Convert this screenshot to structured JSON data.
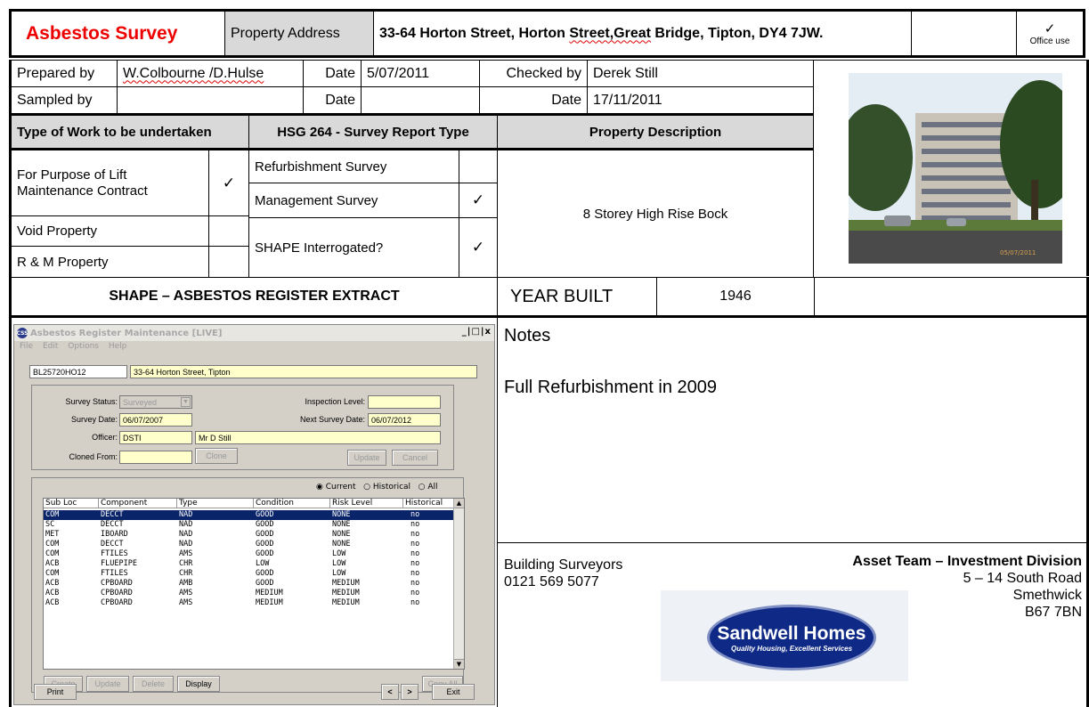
{
  "header": {
    "title": "Asbestos Survey",
    "address_label": "Property Address",
    "address_value_a": "33-64 Horton Street, Horton ",
    "address_value_b": "Street,Great",
    "address_value_c": " Bridge, Tipton, DY4 7JW.",
    "check": "✓",
    "office_use": "Office use"
  },
  "info": {
    "prepared_label": "Prepared by",
    "prepared_value": "W.Colbourne /D.Hulse",
    "date_label": "Date",
    "date1": "5/07/2011",
    "checked_label": "Checked by",
    "checked_value": "Derek Still",
    "sampled_label": "Sampled by",
    "date2_label": "Date",
    "date3_label": "Date",
    "date3": "17/11/2011"
  },
  "sections": {
    "work_type": "Type of Work to be undertaken",
    "hsg": "HSG 264 - Survey Report Type",
    "prop_desc": "Property Description"
  },
  "work": {
    "lift_line1": "For Purpose of Lift",
    "lift_line2": "Maintenance Contract",
    "lift_check": "✓",
    "void": "Void Property",
    "rm": "R & M Property"
  },
  "survey": {
    "refurb": "Refurbishment Survey",
    "mgmt": "Management Survey",
    "mgmt_check": "✓",
    "shape": "SHAPE Interrogated?",
    "shape_check": "✓"
  },
  "property": {
    "description": "8 Storey High Rise Bock",
    "photo_date": "05/07/2011"
  },
  "register_title": "SHAPE – ASBESTOS REGISTER EXTRACT",
  "year": {
    "label": "YEAR BUILT",
    "value": "1946"
  },
  "notes": {
    "label": "Notes",
    "text": "Full Refurbishment in 2009"
  },
  "contact": {
    "dept": "Building Surveyors",
    "phone": "0121 569 5077",
    "team": "Asset Team – Investment Division",
    "addr1": "5 – 14 South Road",
    "addr2": "Smethwick",
    "addr3": "B67 7BN"
  },
  "logo": {
    "name": "Sandwell Homes",
    "tagline": "Quality Housing, Excellent Services"
  },
  "window": {
    "title": "Asbestos Register Maintenance [LIVE]",
    "icon": "CSS",
    "controls": "_|□|x",
    "menu": [
      "File",
      "Edit",
      "Options",
      "Help"
    ],
    "ref": "BL25720HO12",
    "address": "33-64 Horton Street, Tipton",
    "survey_status_label": "Survey Status:",
    "survey_status": "Surveyed",
    "inspection_label": "Inspection Level:",
    "survey_date_label": "Survey Date:",
    "survey_date": "06/07/2007",
    "next_survey_label": "Next Survey Date:",
    "next_survey": "06/07/2012",
    "officer_label": "Officer:",
    "officer_code": "DSTI",
    "officer_name": "Mr D Still",
    "cloned_label": "Cloned From:",
    "clone_btn": "Clone",
    "update_btn": "Update",
    "cancel_btn": "Cancel",
    "radio_current": "Current",
    "radio_historical": "Historical",
    "radio_all": "All",
    "columns": [
      "Sub Loc",
      "Component",
      "Type",
      "Condition",
      "Risk Level",
      "Historical"
    ],
    "rows": [
      [
        "COM",
        "DECCT",
        "NAD",
        "GOOD",
        "NONE",
        "no"
      ],
      [
        "SC",
        "DECCT",
        "NAD",
        "GOOD",
        "NONE",
        "no"
      ],
      [
        "MET",
        "IBOARD",
        "NAD",
        "GOOD",
        "NONE",
        "no"
      ],
      [
        "COM",
        "DECCT",
        "NAD",
        "GOOD",
        "NONE",
        "no"
      ],
      [
        "COM",
        "FTILES",
        "AMS",
        "GOOD",
        "LOW",
        "no"
      ],
      [
        "ACB",
        "FLUEPIPE",
        "CHR",
        "LOW",
        "LOW",
        "no"
      ],
      [
        "COM",
        "FTILES",
        "CHR",
        "GOOD",
        "LOW",
        "no"
      ],
      [
        "ACB",
        "CPBOARD",
        "AMB",
        "GOOD",
        "MEDIUM",
        "no"
      ],
      [
        "ACB",
        "CPBOARD",
        "AMS",
        "MEDIUM",
        "MEDIUM",
        "no"
      ],
      [
        "ACB",
        "CPBOARD",
        "AMS",
        "MEDIUM",
        "MEDIUM",
        "no"
      ]
    ],
    "btn_create": "Create",
    "btn_update": "Update",
    "btn_delete": "Delete",
    "btn_display": "Display",
    "btn_copyall": "Copy All",
    "btn_print": "Print",
    "btn_prev": "<",
    "btn_next": ">",
    "btn_exit": "Exit"
  }
}
